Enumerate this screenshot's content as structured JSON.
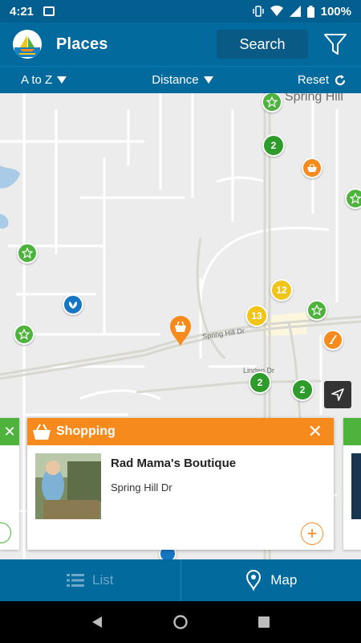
{
  "status_bar": {
    "time": "4:21",
    "battery": "100%"
  },
  "header": {
    "title": "Places",
    "search_label": "Search"
  },
  "sort_bar": {
    "sort_az": "A to Z",
    "sort_distance": "Distance",
    "reset": "Reset"
  },
  "map": {
    "labels": {
      "spring_hill_town": "Spring Hill",
      "spring_hill_dr": "Spring Hill Dr",
      "linden_dr": "Linden Dr"
    },
    "clusters": [
      "2",
      "12",
      "13",
      "2",
      "2"
    ]
  },
  "card": {
    "category": "Shopping",
    "name": "Rad Mama's Boutique",
    "address": "Spring Hill Dr"
  },
  "tabs": {
    "list": "List",
    "map": "Map"
  },
  "colors": {
    "header": "#036a9e",
    "shopping": "#f78a1d",
    "attraction": "#4db33d",
    "cluster_yellow": "#f0c419",
    "cluster_green": "#2e9c2a"
  }
}
